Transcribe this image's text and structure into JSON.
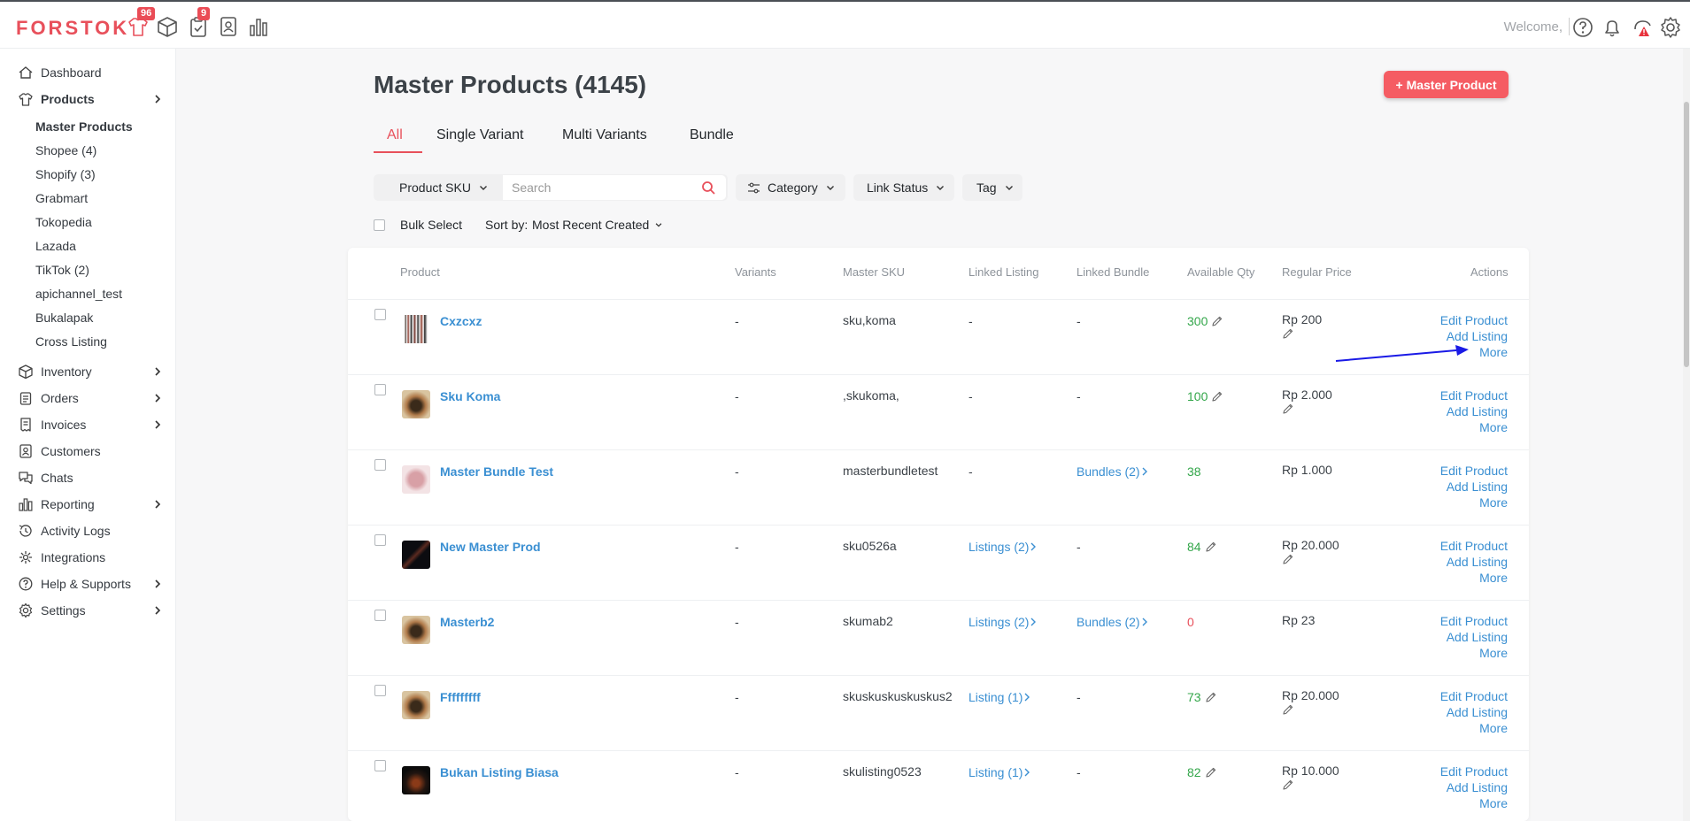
{
  "app": {
    "logo": "FORSTOK",
    "welcome": "Welcome,"
  },
  "badges": {
    "products": "96",
    "orders": "9"
  },
  "sidebar": {
    "items": [
      {
        "label": "Dashboard",
        "icon": "home-icon"
      },
      {
        "label": "Products",
        "icon": "shirt-icon"
      },
      {
        "label": "Inventory",
        "icon": "box-icon"
      },
      {
        "label": "Orders",
        "icon": "clipboard-icon"
      },
      {
        "label": "Invoices",
        "icon": "invoice-icon"
      },
      {
        "label": "Customers",
        "icon": "contact-icon"
      },
      {
        "label": "Chats",
        "icon": "chat-icon"
      },
      {
        "label": "Reporting",
        "icon": "chart-icon"
      },
      {
        "label": "Activity Logs",
        "icon": "activity-icon"
      },
      {
        "label": "Integrations",
        "icon": "integrations-icon"
      },
      {
        "label": "Help & Supports",
        "icon": "help-icon"
      },
      {
        "label": "Settings",
        "icon": "gear-icon"
      }
    ],
    "products_sub": [
      "Master Products",
      "Shopee (4)",
      "Shopify (3)",
      "Grabmart",
      "Tokopedia",
      "Lazada",
      "TikTok (2)",
      "apichannel_test",
      "Bukalapak",
      "Cross Listing"
    ]
  },
  "main": {
    "title": "Master Products (4145)",
    "add_button": "+ Master Product",
    "tabs": [
      "All",
      "Single Variant",
      "Multi Variants",
      "Bundle"
    ],
    "filters": {
      "sku_select": "Product SKU",
      "search_placeholder": "Search",
      "category": "Category",
      "link_status": "Link Status",
      "tag": "Tag"
    },
    "bulk_select": "Bulk Select",
    "sort_label": "Sort by:",
    "sort_value": "Most Recent Created"
  },
  "table": {
    "headers": [
      "Product",
      "Variants",
      "Master SKU",
      "Linked Listing",
      "Linked Bundle",
      "Available Qty",
      "Regular Price",
      "Actions"
    ],
    "actions": [
      "Edit Product",
      "Add Listing",
      "More"
    ],
    "rows": [
      {
        "name": "Cxzcxz",
        "variants": "-",
        "sku": "sku,koma",
        "listing": "-",
        "bundle": "-",
        "qty": "300",
        "price": "Rp 200"
      },
      {
        "name": "Sku Koma",
        "variants": "-",
        "sku": ",skukoma,",
        "listing": "-",
        "bundle": "-",
        "qty": "100",
        "price": "Rp 2.000"
      },
      {
        "name": "Master Bundle Test",
        "variants": "-",
        "sku": "masterbundletest",
        "listing": "-",
        "bundle": "Bundles (2)",
        "qty": "38",
        "price": "Rp 1.000"
      },
      {
        "name": "New Master Prod",
        "variants": "-",
        "sku": "sku0526a",
        "listing": "Listings (2)",
        "bundle": "-",
        "qty": "84",
        "price": "Rp 20.000"
      },
      {
        "name": "Masterb2",
        "variants": "-",
        "sku": "skumab2",
        "listing": "Listings (2)",
        "bundle": "Bundles (2)",
        "qty": "0",
        "price": "Rp 23"
      },
      {
        "name": "Fffffffff",
        "variants": "-",
        "sku": "skuskuskuskuskus2",
        "listing": "Listing (1)",
        "bundle": "-",
        "qty": "73",
        "price": "Rp 20.000"
      },
      {
        "name": "Bukan Listing Biasa",
        "variants": "-",
        "sku": "skulisting0523",
        "listing": "Listing (1)",
        "bundle": "-",
        "qty": "82",
        "price": "Rp 10.000"
      }
    ]
  },
  "colors": {
    "brand": "#e8505b",
    "link": "#3a8fd2",
    "qty_green": "#33a64a",
    "annotation_arrow": "#1a1ae6"
  }
}
